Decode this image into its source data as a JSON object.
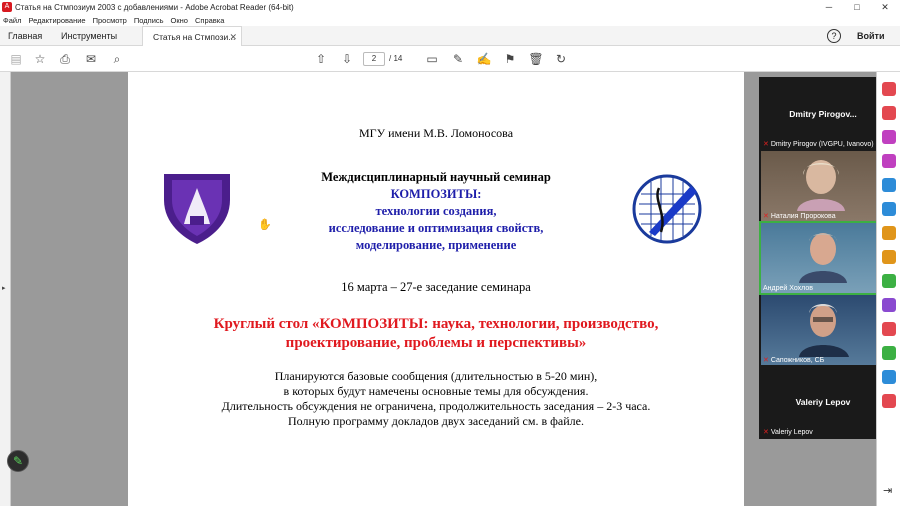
{
  "window": {
    "title": "Статья на Стмпозиум 2003 с добавлениями - Adobe Acrobat Reader (64-bit)",
    "app_icon": "acrobat-icon",
    "controls": [
      "─",
      "□",
      "✕"
    ]
  },
  "menu": [
    "Файл",
    "Редактирование",
    "Просмотр",
    "Подпись",
    "Окно",
    "Справка"
  ],
  "tabs": {
    "home": "Главная",
    "tools": "Инструменты",
    "document": "Статья на Стмпози...",
    "help": "?",
    "signin": "Войти"
  },
  "toolbar": {
    "page_current": "2",
    "page_total": "/ 14"
  },
  "document": {
    "university": "МГУ имени М.В. Ломоносова",
    "seminar": "Междисциплинарный научный семинар",
    "topic_lines": [
      "КОМПОЗИТЫ:",
      "технологии создания,",
      "исследование и оптимизация свойств,",
      "моделирование, применение"
    ],
    "date_line": "16 марта – 27-е заседание семинара",
    "roundtable_lines": [
      "Круглый стол  «КОМПОЗИТЫ: наука, технологии, производство,",
      "проектирование, проблемы и перспективы»"
    ],
    "body_lines": [
      "Планируются базовые сообщения (длительностью в 5-20 мин),",
      "в которых будут намечены основные темы для обсуждения.",
      "Длительность обсуждения не ограничена, продолжительность заседания – 2-3 часа.",
      "Полную программу докладов двух заседаний см. в файле."
    ]
  },
  "zoom": {
    "participants": [
      {
        "big_name": "Dmitry  Pirogov...",
        "label": "Dmitry Pirogov (IVGPU, Ivanovo)"
      },
      {
        "label": "Наталия Пророкова"
      },
      {
        "label": "Андрей Хохлов"
      },
      {
        "label": "Сапожников, СБ"
      },
      {
        "big_name": "Valeriy Lepov",
        "label": "Valeriy Lepov"
      }
    ]
  },
  "colors": {
    "blue_text": "#1e1eaa",
    "red_text": "#e0191f",
    "acrobat_red": "#d71920",
    "zoom_active_border": "#3cb043"
  }
}
